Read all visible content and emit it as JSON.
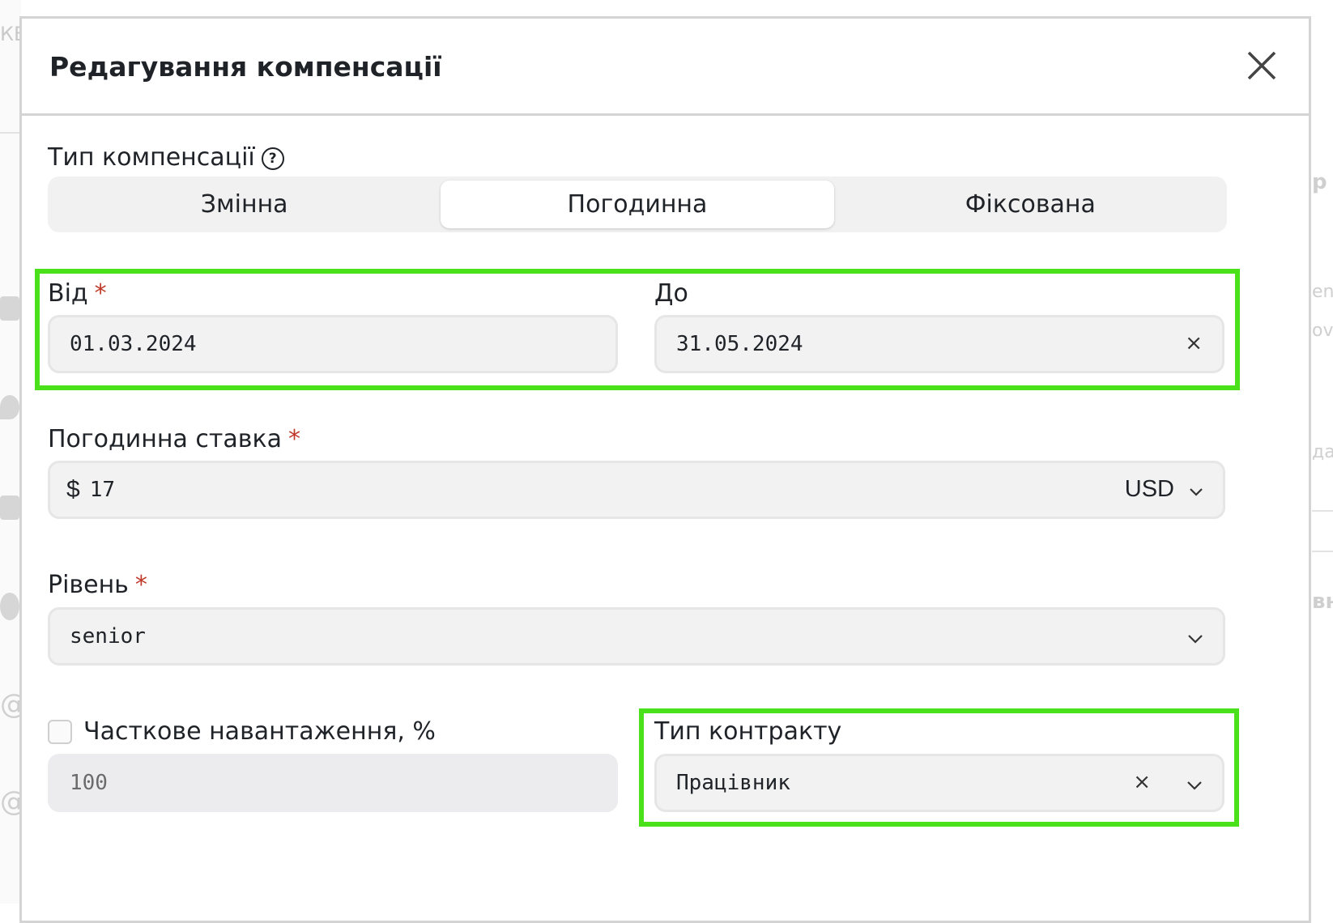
{
  "background": {
    "left_fragment": "КЕ",
    "right_fragments": [
      "р",
      "ens",
      "ove",
      "дат",
      "вн"
    ]
  },
  "modal": {
    "title": "Редагування компенсації",
    "close_icon": "close-icon"
  },
  "compensation_type": {
    "label": "Тип компенсації",
    "help_icon": "?",
    "options": [
      "Змінна",
      "Погодинна",
      "Фіксована"
    ],
    "selected": "Погодинна"
  },
  "date_range": {
    "from_label": "Від",
    "from_value": "01.03.2024",
    "to_label": "До",
    "to_value": "31.05.2024",
    "clear_symbol": "×"
  },
  "hourly_rate": {
    "label": "Погодинна ставка",
    "currency_symbol": "$",
    "value": "17",
    "currency": "USD"
  },
  "level": {
    "label": "Рівень",
    "value": "senior"
  },
  "part_time": {
    "label": "Часткове навантаження, %",
    "checked": false,
    "value": "100"
  },
  "contract_type": {
    "label": "Тип контракту",
    "value": "Працівник",
    "clear_symbol": "×"
  },
  "required_marker": "*",
  "colors": {
    "highlight": "#4ae01a",
    "required": "#c0392b"
  }
}
